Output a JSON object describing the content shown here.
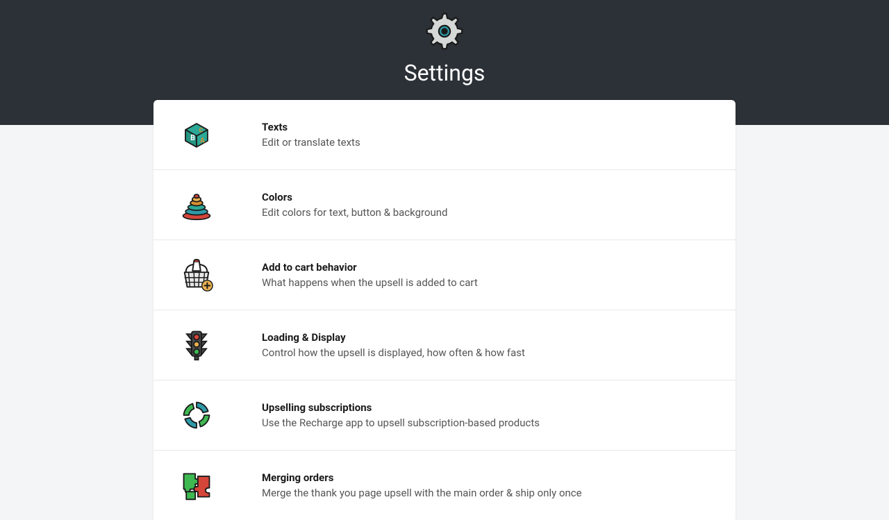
{
  "header": {
    "title": "Settings"
  },
  "items": [
    {
      "title": "Texts",
      "description": "Edit or translate texts"
    },
    {
      "title": "Colors",
      "description": "Edit colors for text, button & background"
    },
    {
      "title": "Add to cart behavior",
      "description": "What happens when the upsell is added to cart"
    },
    {
      "title": "Loading & Display",
      "description": "Control how the upsell is displayed, how often & how fast"
    },
    {
      "title": "Upselling subscriptions",
      "description": "Use the Recharge app to upsell subscription-based products"
    },
    {
      "title": "Merging orders",
      "description": "Merge the thank you page upsell with the main order & ship only once"
    }
  ]
}
